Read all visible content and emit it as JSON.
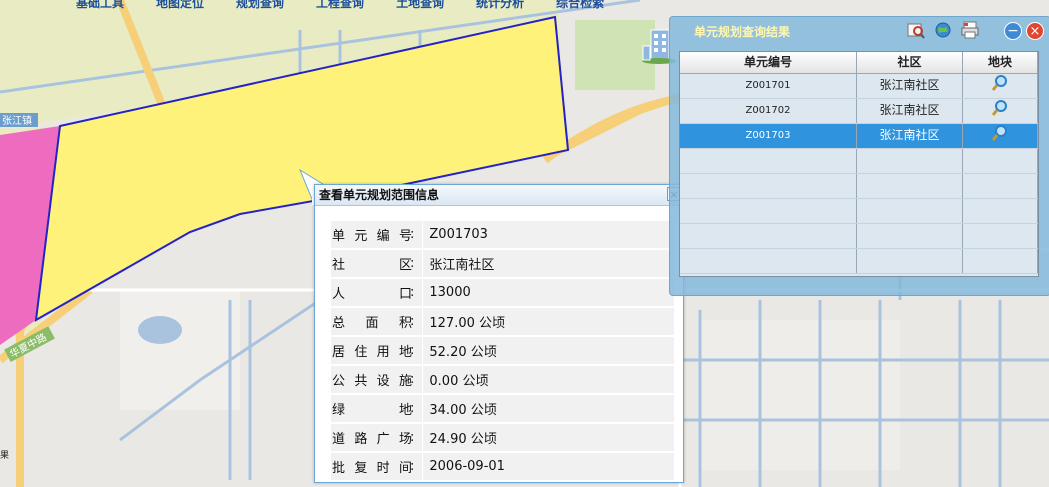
{
  "menu": [
    "基础工具",
    "地图定位",
    "规划查询",
    "工程查询",
    "土地查询",
    "统计分析",
    "综合检索"
  ],
  "map": {
    "labels": {
      "town": "张江镇",
      "road": "华夏中路",
      "edge": "果"
    },
    "colors": {
      "plot": "#fff27a",
      "plot_border": "#2323c6",
      "pink_area": "#ee6cc0",
      "green_area": "#e8ecc0",
      "water": "#a9c3df",
      "road": "#f8d37a"
    }
  },
  "popup": {
    "title": "查看单元规划范围信息",
    "close_glyph": "×",
    "rows": [
      {
        "label": "单元编号",
        "sep": ":",
        "value": "Z001703"
      },
      {
        "label": "社　　区",
        "sep": ":",
        "value": "张江南社区"
      },
      {
        "label": "人　　口",
        "sep": ":",
        "value": "13000"
      },
      {
        "label": "总 面 积",
        "sep": ":",
        "value": "127.00 公顷"
      },
      {
        "label": "居住用地",
        "sep": ":",
        "value": "52.20 公顷"
      },
      {
        "label": "公共设施",
        "sep": ":",
        "value": "0.00 公顷"
      },
      {
        "label": "绿　　地",
        "sep": ":",
        "value": "34.00 公顷"
      },
      {
        "label": "道路广场",
        "sep": ":",
        "value": "24.90 公顷"
      },
      {
        "label": "批复时间",
        "sep": ":",
        "value": "2006-09-01"
      }
    ]
  },
  "panel": {
    "title": "单元规划查询结果",
    "tool_icons": [
      "zoom-map-icon",
      "globe-icon",
      "print-icon"
    ],
    "minimize_glyph": "−",
    "close_glyph": "×",
    "columns": [
      "单元编号",
      "社区",
      "地块"
    ],
    "rows": [
      {
        "code": "Z001701",
        "community": "张江南社区",
        "icon": "magnifier-icon",
        "selected": false
      },
      {
        "code": "Z001702",
        "community": "张江南社区",
        "icon": "magnifier-icon",
        "selected": false
      },
      {
        "code": "Z001703",
        "community": "张江南社区",
        "icon": "magnifier-icon",
        "selected": true
      }
    ],
    "empty_rows": 5
  }
}
